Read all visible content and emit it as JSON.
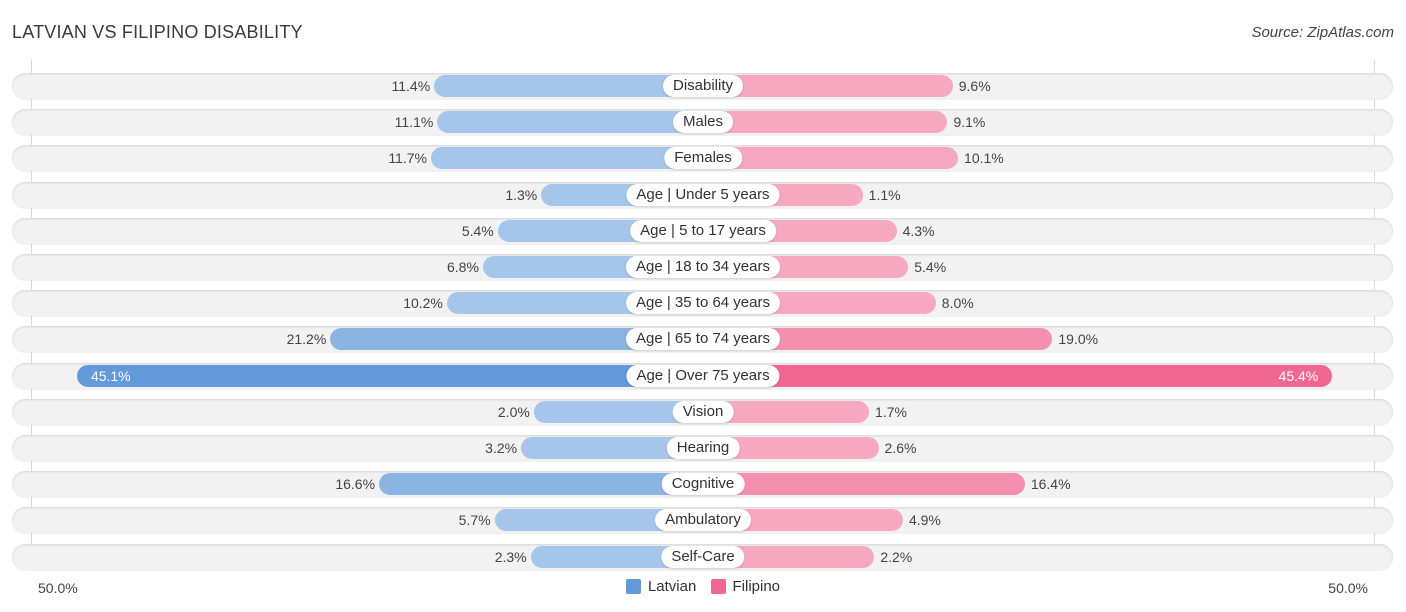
{
  "header": {
    "title": "LATVIAN VS FILIPINO DISABILITY",
    "source": "Source: ZipAtlas.com"
  },
  "colors": {
    "latvian_strong": "#6399d9",
    "latvian_light": "#a5c6ea",
    "filipino_strong": "#f06791",
    "filipino_light": "#f6a8c0"
  },
  "chart_data": {
    "type": "bar",
    "orientation": "horizontal-diverging",
    "title": "LATVIAN VS FILIPINO DISABILITY",
    "categories": [
      "Disability",
      "Males",
      "Females",
      "Age | Under 5 years",
      "Age | 5 to 17 years",
      "Age | 18 to 34 years",
      "Age | 35 to 64 years",
      "Age | 65 to 74 years",
      "Age | Over 75 years",
      "Vision",
      "Hearing",
      "Cognitive",
      "Ambulatory",
      "Self-Care"
    ],
    "series": [
      {
        "name": "Latvian",
        "side": "left",
        "values": [
          11.4,
          11.1,
          11.7,
          1.3,
          5.4,
          6.8,
          10.2,
          21.2,
          45.1,
          2.0,
          3.2,
          16.6,
          5.7,
          2.3
        ],
        "labels": [
          "11.4%",
          "11.1%",
          "11.7%",
          "1.3%",
          "5.4%",
          "6.8%",
          "10.2%",
          "21.2%",
          "45.1%",
          "2.0%",
          "3.2%",
          "16.6%",
          "5.7%",
          "2.3%"
        ]
      },
      {
        "name": "Filipino",
        "side": "right",
        "values": [
          9.6,
          9.1,
          10.1,
          1.1,
          4.3,
          5.4,
          8.0,
          19.0,
          45.4,
          1.7,
          2.6,
          16.4,
          4.9,
          2.2
        ],
        "labels": [
          "9.6%",
          "9.1%",
          "10.1%",
          "1.1%",
          "4.3%",
          "5.4%",
          "8.0%",
          "19.0%",
          "45.4%",
          "1.7%",
          "2.6%",
          "16.4%",
          "4.9%",
          "2.2%"
        ]
      }
    ],
    "axis": {
      "left_label": "50.0%",
      "right_label": "50.0%",
      "max": 50.0,
      "unit": "%"
    },
    "legend": {
      "placement": "bottom-center",
      "items": [
        "Latvian",
        "Filipino"
      ]
    },
    "grid": false
  }
}
